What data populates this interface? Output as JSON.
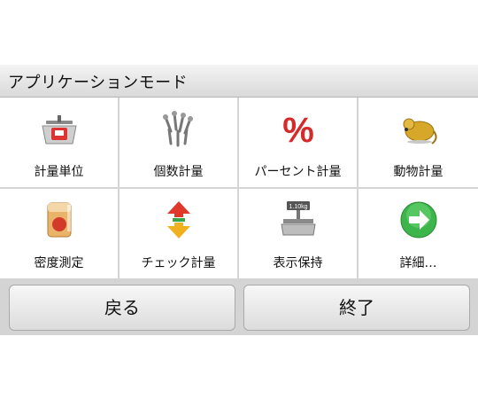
{
  "header": {
    "title": "アプリケーションモード"
  },
  "tiles": [
    {
      "label": "計量単位",
      "icon": "scale-unit-icon"
    },
    {
      "label": "個数計量",
      "icon": "parts-count-icon"
    },
    {
      "label": "パーセント計量",
      "icon": "percent-icon"
    },
    {
      "label": "動物計量",
      "icon": "animal-mouse-icon"
    },
    {
      "label": "密度測定",
      "icon": "density-beaker-icon"
    },
    {
      "label": "チェック計量",
      "icon": "check-weigh-arrows-icon"
    },
    {
      "label": "表示保持",
      "icon": "display-hold-scale-icon"
    },
    {
      "label": "詳細…",
      "icon": "next-arrow-icon"
    }
  ],
  "display_hold_value": "1.10kg",
  "buttons": {
    "back": "戻る",
    "exit": "終了"
  },
  "colors": {
    "percent": "#d62a2a",
    "next_arrow": "#3cb54a",
    "header": "#dcdcdc"
  }
}
